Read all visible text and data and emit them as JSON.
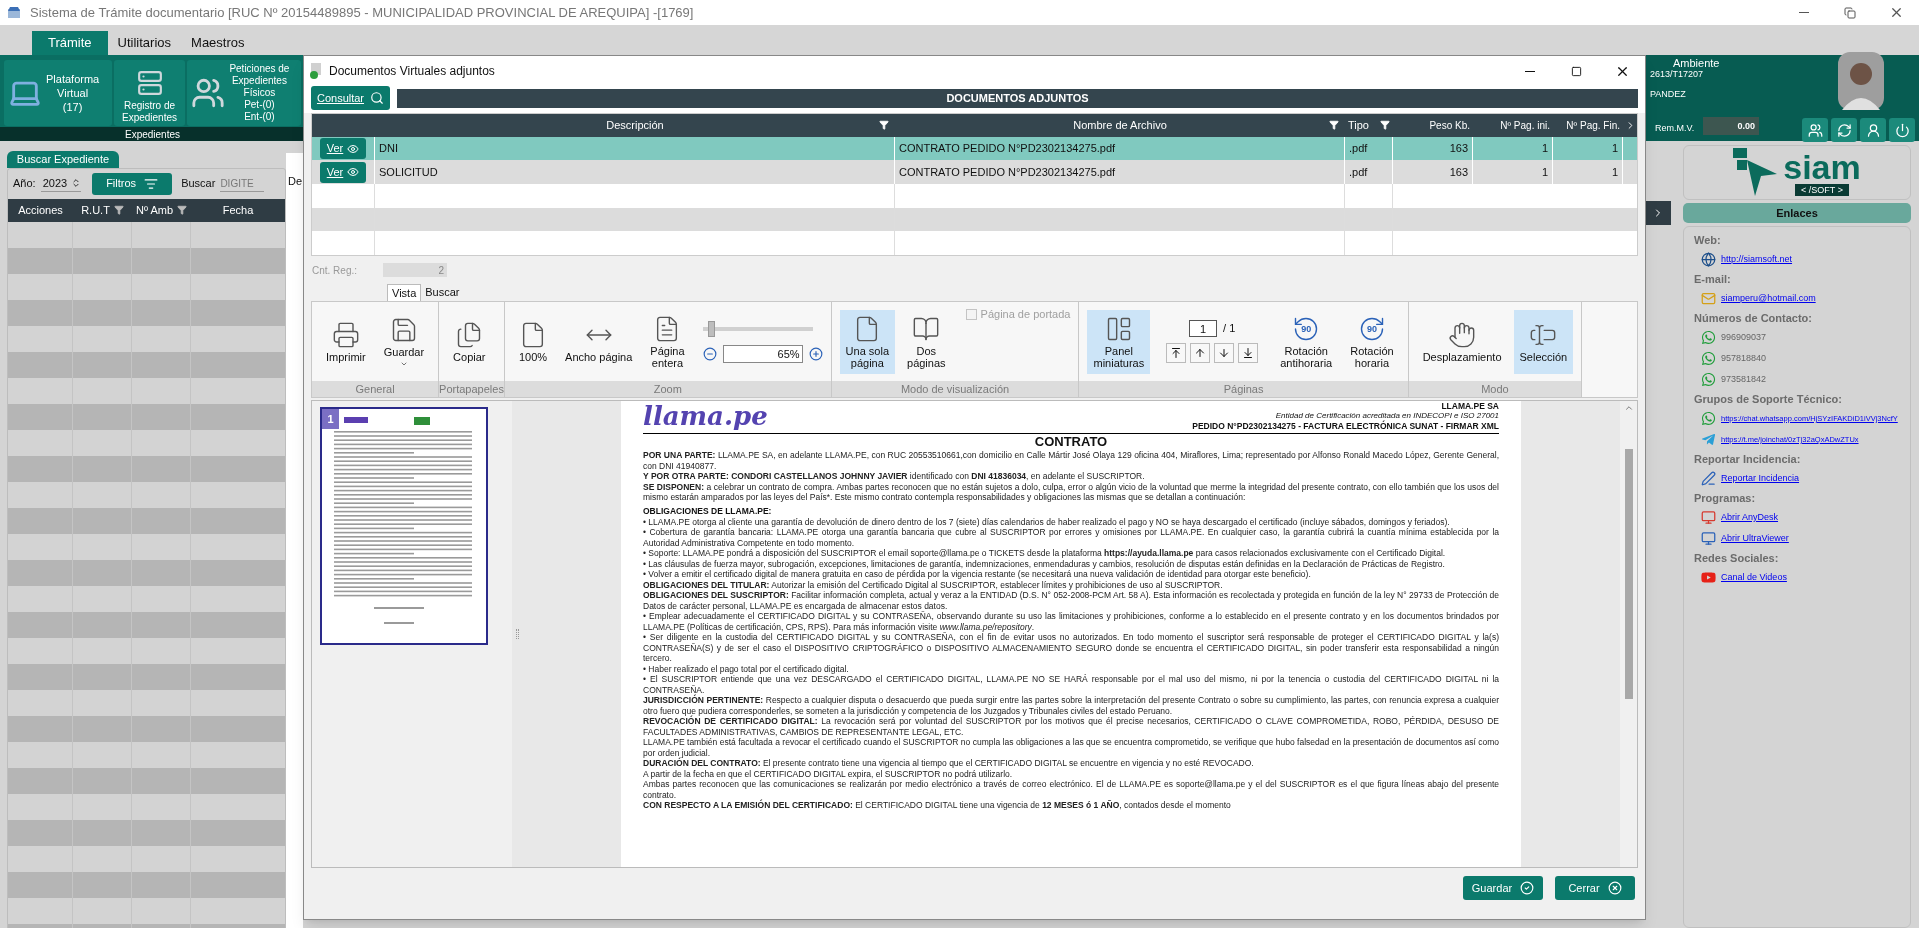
{
  "window": {
    "title": "Sistema de Trámite documentario [RUC Nº 20154489895 - MUNICIPALIDAD PROVINCIAL DE AREQUIPA] -[1769]"
  },
  "menu_tabs": [
    {
      "label": "Trámite",
      "selected": true
    },
    {
      "label": "Utilitarios",
      "selected": false
    },
    {
      "label": "Maestros",
      "selected": false
    }
  ],
  "ribbon": {
    "buttons": [
      "Plataforma\nVirtual\n(17)",
      "Registro de\nExpedientes",
      "Peticiones de\nExpedientes\nFísicos\nPet-(0)\nEnt-(0)"
    ],
    "group": "Expedientes"
  },
  "user": {
    "environment": "Ambiente",
    "code": "2613/T17207",
    "name": "PANDEZ",
    "rem_label": "Rem.M.V.",
    "rem_value": "0.00"
  },
  "search_panel": {
    "tab": "Buscar Expediente",
    "year_label": "Año:",
    "year": "2023",
    "filters_button": "Filtros",
    "search_label": "Buscar",
    "search_placeholder": "DIGITE",
    "behind_label": "De",
    "columns": [
      {
        "label": "Acciones",
        "filter": false
      },
      {
        "label": "R.U.T",
        "filter": true
      },
      {
        "label": "Nº Amb",
        "filter": true
      },
      {
        "label": "Fecha",
        "filter": false
      }
    ]
  },
  "right_panel": {
    "logo": {
      "name": "siam",
      "tag": "< /SOFT >"
    },
    "links_title": "Enlaces",
    "sections": [
      {
        "title": "Web:",
        "items": [
          {
            "text": "http://siamsoft.net",
            "link": true
          }
        ]
      },
      {
        "title": "E-mail:",
        "items": [
          {
            "text": "siamperu@hotmail.com",
            "link": true
          }
        ]
      },
      {
        "title": "Números de Contacto:",
        "items": [
          {
            "text": "996909037",
            "link": false
          },
          {
            "text": "957818840",
            "link": false
          },
          {
            "text": "973581842",
            "link": false
          }
        ]
      },
      {
        "title": "Grupos de Soporte Técnico:",
        "items": [
          {
            "text": "https://chat.whatsapp.com/HjSYzIFAKDiD1iVVj3NcfY",
            "link": true
          },
          {
            "text": "https://t.me/joinchat/0zTj32aQxADwZTUx",
            "link": true
          }
        ]
      },
      {
        "title": "Reportar Incidencia:",
        "items": [
          {
            "text": "Reportar Incidencia",
            "link": true
          }
        ]
      },
      {
        "title": "Programas:",
        "items": [
          {
            "text": "Abrir AnyDesk",
            "link": true
          },
          {
            "text": "Abrir UltraViewer",
            "link": true
          }
        ]
      },
      {
        "title": "Redes Sociales:",
        "items": [
          {
            "text": "Canal de Videos",
            "link": true
          }
        ]
      }
    ]
  },
  "dialog": {
    "title": "Documentos Virtuales adjuntos",
    "consult_button": "Consultar",
    "table": {
      "title": "DOCUMENTOS ADJUNTOS",
      "columns": [
        {
          "label": "Descripción",
          "filter": true
        },
        {
          "label": "Nombre de Archivo",
          "filter": true
        },
        {
          "label": "Tipo",
          "filter": true
        },
        {
          "label": "Peso Kb.",
          "filter": false
        },
        {
          "label": "Nº Pag. ini.",
          "filter": false
        },
        {
          "label": "Nº Pag. Fin.",
          "filter": false
        }
      ],
      "rows": [
        {
          "action": "Ver",
          "selected": true,
          "cells": [
            "DNI",
            "CONTRATO PEDIDO N°PD2302134275.pdf",
            ".pdf",
            "163",
            "1",
            "1"
          ]
        },
        {
          "action": "Ver",
          "selected": false,
          "cells": [
            "SOLICITUD",
            "CONTRATO PEDIDO N°PD2302134275.pdf",
            ".pdf",
            "163",
            "1",
            "1"
          ]
        }
      ]
    },
    "count_label": "Cnt. Reg.:",
    "count": "2",
    "toolbar": {
      "tabs": [
        {
          "label": "Vista",
          "selected": true
        },
        {
          "label": "Buscar",
          "selected": false
        }
      ],
      "groups": [
        {
          "kind": "basic",
          "label": "General",
          "buttons": [
            {
              "label": "Imprimir",
              "selected": false,
              "dropdown": false
            },
            {
              "label": "Guardar",
              "selected": false,
              "dropdown": true
            }
          ]
        },
        {
          "kind": "basic",
          "label": "Portapapeles",
          "buttons": [
            {
              "label": "Copiar",
              "selected": false,
              "dropdown": false
            }
          ]
        },
        {
          "kind": "zoom",
          "label": "Zoom",
          "buttons": [
            {
              "label": "100%",
              "selected": false,
              "dropdown": false
            },
            {
              "label": "Ancho página",
              "selected": false,
              "dropdown": false
            },
            {
              "label": "Página\nentera",
              "selected": false,
              "dropdown": false
            }
          ],
          "slider": {
            "level": 0.05
          },
          "zoom_value": "65%"
        },
        {
          "kind": "view",
          "label": "Modo de visualización",
          "buttons": [
            {
              "label": "Una sola\npágina",
              "selected": true,
              "dropdown": false
            },
            {
              "label": "Dos\npáginas",
              "selected": false,
              "dropdown": false
            }
          ],
          "checkbox": {
            "label": "Página de portada",
            "checked": false,
            "disabled": true
          }
        },
        {
          "kind": "pages",
          "label": "Páginas",
          "buttons": [
            {
              "label": "Panel\nminiaturas",
              "selected": true,
              "dropdown": false
            },
            {
              "label": "Rotación\nantihoraria",
              "selected": false,
              "dropdown": false,
              "badge": "90"
            },
            {
              "label": "Rotación\nhoraria",
              "selected": false,
              "dropdown": false,
              "badge": "90"
            }
          ],
          "page_value": "1",
          "page_total": "/ 1"
        },
        {
          "kind": "basic",
          "label": "Modo",
          "buttons": [
            {
              "label": "Desplazamiento",
              "selected": false,
              "dropdown": false
            },
            {
              "label": "Selección",
              "selected": true,
              "dropdown": false
            }
          ]
        }
      ]
    },
    "thumbnail_page": "1",
    "document": {
      "logo": "llama.pe",
      "header_right": [
        "LLAMA.PE SA",
        "Entidad de Certificación acreditada en INDECOPI e ISO 27001",
        "PEDIDO N°PD2302134275 - FACTURA ELECTRÓNICA SUNAT - FIRMAR XML"
      ],
      "title": "CONTRATO",
      "paragraphs": [
        {
          "kind": "text",
          "text": "**POR UNA PARTE:** LLAMA.PE SA, en adelante LLAMA.PE, con RUC 20553510661,con domicilio en Calle Mártir José Olaya 129 oficina 404, Miraflores, Lima; representado por Alfonso Ronald Macedo López, Gerente General, con DNI 41940877."
        },
        {
          "kind": "text",
          "text": "**Y POR OTRA PARTE: CONDORI CASTELLANOS JOHNNY JAVIER** identificado con **DNI 41836034**, en adelante el SUSCRIPTOR."
        },
        {
          "kind": "text",
          "text": "**SE DISPONEN:** a celebrar un contrato de compra. Ambas partes reconocen que no están sujetos a dolo, culpa, error o algún vicio de la voluntad que merme la integridad del presente contrato, con ello también que los usos del mismo estarán amparados por las leyes del País*. Este mismo contrato contempla responsabilidades y obligaciones las mismas que se detallan a continuación:"
        },
        {
          "kind": "heading",
          "text": "OBLIGACIONES DE LLAMA.PE:"
        },
        {
          "kind": "text",
          "text": "• LLAMA.PE otorga al cliente una garantía de devolución de dinero dentro de los 7 (siete) días calendarios de haber realizado el pago y NO se haya descargado el certificado (incluye sábados, domingos y feriados)."
        },
        {
          "kind": "text",
          "text": "• Cobertura de garantía bancaria: LLAMA.PE otorga una garantía bancaria que cubre al SUSCRIPTOR por errores y omisiones por LLAMA.PE. En cualquier caso, la garantía cubrirá la cuantía mínima establecida por la Autoridad Administrativa Competente en todo momento."
        },
        {
          "kind": "text",
          "text": "• Soporte: LLAMA.PE pondrá a disposición del SUSCRIPTOR el email soporte@llama.pe o TICKETS desde la plataforma **https://ayuda.llama.pe** para casos relacionados exclusivamente con el Certificado Digital."
        },
        {
          "kind": "text",
          "text": "• Las cláusulas de fuerza mayor, subrogación, excepciones, limitaciones de garantía, indemnizaciones, enmendaduras y cambios, resolución de disputas están definidas en la Declaración de Prácticas de Registro."
        },
        {
          "kind": "text",
          "text": "• Volver a emitir el certificado digital de manera gratuita en caso de pérdida por la vigencia restante (se necesitará una nueva validación de identidad para otorgar este beneficio)."
        },
        {
          "kind": "text",
          "text": "**OBLIGACIONES DEL TITULAR:** Autorizar la emisión del Certificado Digital al SUSCRIPTOR, establecer límites y prohibiciones de uso al SUSCRIPTOR."
        },
        {
          "kind": "text",
          "text": "**OBLIGACIONES DEL SUSCRIPTOR:** Facilitar información completa, actual y veraz a la ENTIDAD (D.S. N° 052-2008-PCM Art. 58 A). Esta información es recolectada y protegida en función de la ley N° 29733 de Protección de Datos de carácter personal, LLAMA.PE es encargada de almacenar estos datos."
        },
        {
          "kind": "text",
          "text": "• Emplear adecuadamente el CERTIFICADO DIGITAL y su CONTRASEÑA, observando durante su uso las limitaciones y prohibiciones, conforme a lo establecido en el presente contrato y en los documentos brindados por LLAMA.PE (Políticas de certificación, CPS, RPS). Para más información visite *www.llama.pe/repository*."
        },
        {
          "kind": "text",
          "text": "• Ser diligente en la custodia del CERTIFICADO DIGITAL y su CONTRASEÑA, con el fin de evitar usos no autorizados. En todo momento el suscriptor será responsable de proteger el CERTIFICADO DIGITAL y la(s) CONTRASEÑA(S) y de ser el caso el DISPOSITIVO CRIPTOGRÁFICO o DISPOSITIVO ALMACENAMIENTO SEGURO donde se encuentra el CERTIFICADO DIGITAL, sin poder transferir esta responsabilidad a ningún tercero."
        },
        {
          "kind": "text",
          "text": "• Haber realizado el pago total por el certificado digital."
        },
        {
          "kind": "text",
          "text": "• El SUSCRIPTOR entiende que una vez DESCARGADO el CERTIFICADO DIGITAL, LLAMA.PE NO SE HARÁ responsable por el mal uso del mismo, ni por la tenencia o custodia del CERTIFICADO DIGITAL ni la CONTRASEÑA."
        },
        {
          "kind": "text",
          "text": "**JURISDICCIÓN PERTINENTE:** Respecto a cualquier disputa o desacuerdo que pueda surgir entre las partes sobre la interpretación del presente Contrato o sobre su cumplimiento, las partes, con renuncia expresa a cualquier otro fuero que pudiera corresponderles, se someten a la jurisdicción y competencia de los Juzgados y Tribunales civiles del estado Peruano."
        },
        {
          "kind": "text",
          "text": "**REVOCACIÓN DE CERTIFICADO DIGITAL:** La revocación será por voluntad del SUSCRIPTOR por los motivos que él precise necesarios, CERTIFICADO O CLAVE COMPROMETIDA, ROBO, PÉRDIDA, DESUSO DE FACULTADES ADMINISTRATIVAS, CAMBIOS DE REPRESENTANTE LEGAL, ETC."
        },
        {
          "kind": "text",
          "text": "LLAMA.PE también está facultada a revocar el certificado cuando el SUSCRIPTOR no cumpla las obligaciones a las que se encuentra comprometido, se verifique que hubo falsedad en la presentación de documentos así como por orden judicial."
        },
        {
          "kind": "text",
          "text": "**DURACIÓN DEL CONTRATO:** El presente contrato tiene una vigencia al tiempo que el CERTIFICADO DIGITAL se encuentre en vigencia y no esté REVOCADO."
        },
        {
          "kind": "text",
          "text": "A partir de la fecha en que el CERTIFICADO DIGITAL expira, el SUSCRIPTOR no podrá utilizarlo."
        },
        {
          "kind": "text",
          "text": "Ambas partes reconocen que las comunicaciones se realizarán por medio electrónico a través de correo electrónico. El de LLAMA.PE es soporte@llama.pe y el del SUSCRIPTOR es el que figura líneas abajo del presente contrato."
        },
        {
          "kind": "text",
          "text": "**CON RESPECTO A LA EMISIÓN DEL CERTIFICADO:** El CERTIFICADO DIGITAL tiene una vigencia de **12 MESES ó 1 AÑO**, contados desde el momento"
        }
      ]
    },
    "buttons": [
      {
        "kind": "save",
        "label": "Guardar"
      },
      {
        "kind": "close",
        "label": "Cerrar"
      }
    ]
  }
}
